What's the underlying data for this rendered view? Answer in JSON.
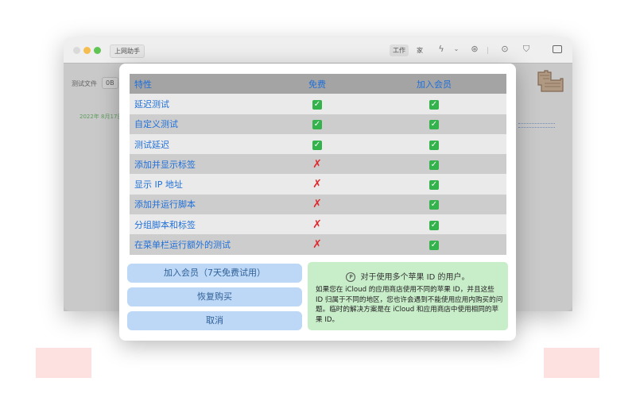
{
  "app": {
    "tab_title": "上网助手",
    "segments": [
      "工作",
      "家"
    ],
    "toolbar_icons": [
      "lightning-icon",
      "chevron-down-icon",
      "bug-icon",
      "send-icon",
      "cart-icon",
      "sidebar-icon"
    ]
  },
  "content": {
    "label": "测试文件",
    "size": "0B",
    "date": "2022年 8月17日"
  },
  "table": {
    "headers": {
      "feature": "特性",
      "free": "免费",
      "member": "加入会员"
    },
    "rows": [
      {
        "feature": "延迟测试",
        "free": "✓",
        "member": "✓"
      },
      {
        "feature": "自定义测试",
        "free": "✓",
        "member": "✓"
      },
      {
        "feature": "测试延迟",
        "free": "✓",
        "member": "✓"
      },
      {
        "feature": "添加并显示标签",
        "free": "✗",
        "member": "✓"
      },
      {
        "feature": "显示 IP 地址",
        "free": "✗",
        "member": "✓"
      },
      {
        "feature": "添加并运行脚本",
        "free": "✗",
        "member": "✓"
      },
      {
        "feature": "分组脚本和标签",
        "free": "✗",
        "member": "✓"
      },
      {
        "feature": "在菜单栏运行额外的测试",
        "free": "✗",
        "member": "✓"
      }
    ]
  },
  "buttons": {
    "join": "加入会员（7天免费试用）",
    "restore": "恢复购买",
    "cancel": "取消"
  },
  "notice": {
    "title": "对于使用多个苹果 ID 的用户。",
    "body": "如果您在 iCloud 的应用商店使用不同的苹果 ID，并且这些 ID 归属于不同的地区，您也许会遇到不能使用应用内购买的问题。临时的解决方案是在 iCloud 和应用商店中使用相同的苹果 ID。"
  },
  "colors": {
    "accent": "#1f6fd8",
    "check": "#34b24c",
    "cross": "#e0282d",
    "button_bg": "#bcd8f6",
    "notice_bg": "#c8edc9"
  }
}
